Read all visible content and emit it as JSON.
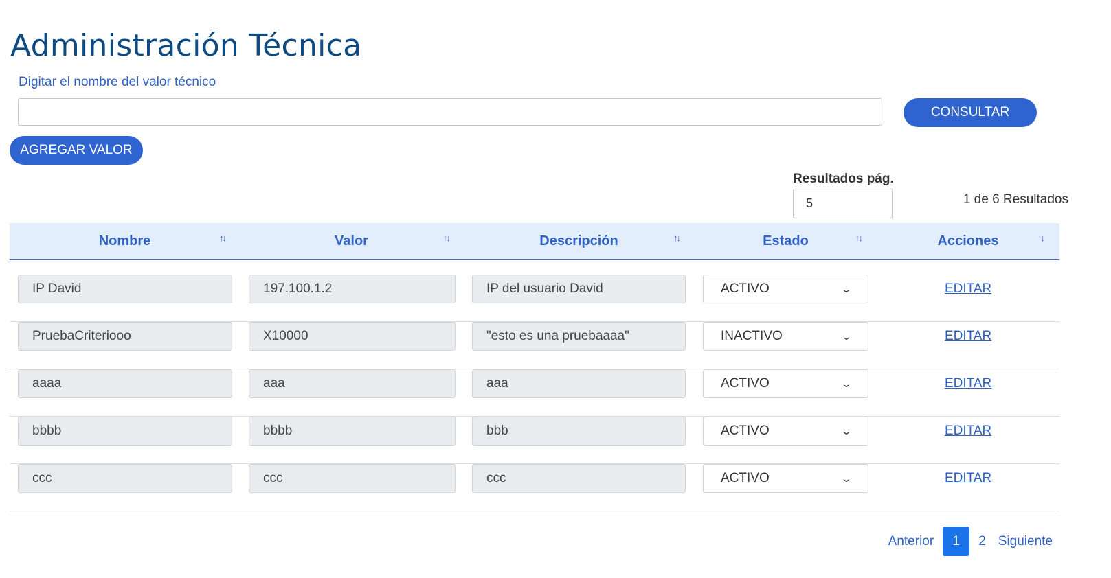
{
  "page": {
    "title": "Administración Técnica"
  },
  "search": {
    "label": "Digitar el nombre del valor técnico",
    "value": "",
    "placeholder": "",
    "consultar_label": "CONSULTAR",
    "agregar_label": "AGREGAR VALOR"
  },
  "paging": {
    "rpp_label": "Resultados pág.",
    "rpp_value": "5",
    "count_text": "1 de 6 Resultados"
  },
  "table": {
    "headers": [
      "Nombre",
      "Valor",
      "Descripción",
      "Estado",
      "Acciones"
    ],
    "rows": [
      {
        "nombre": "IP David",
        "valor": "197.100.1.2",
        "descripcion": "IP del usuario David",
        "estado": "ACTIVO",
        "accion": "EDITAR"
      },
      {
        "nombre": "PruebaCriteriooo",
        "valor": "X10000",
        "descripcion": "\"esto es una pruebaaaa\"",
        "estado": "INACTIVO",
        "accion": "EDITAR"
      },
      {
        "nombre": "aaaa",
        "valor": "aaa",
        "descripcion": "aaa",
        "estado": "ACTIVO",
        "accion": "EDITAR"
      },
      {
        "nombre": "bbbb",
        "valor": "bbbb",
        "descripcion": "bbb",
        "estado": "ACTIVO",
        "accion": "EDITAR"
      },
      {
        "nombre": "ccc",
        "valor": "ccc",
        "descripcion": "ccc",
        "estado": "ACTIVO",
        "accion": "EDITAR"
      }
    ]
  },
  "pagination": {
    "prev_label": "Anterior",
    "pages": [
      "1",
      "2"
    ],
    "active_page": "1",
    "next_label": "Siguiente"
  },
  "colors": {
    "primary": "#2f63cf",
    "title": "#0d4a82",
    "header_bg": "#e3eefc",
    "field_bg": "#e9ecef"
  },
  "icons": {
    "sort": "sort-arrows-icon",
    "dropdown": "chevron-down-icon"
  }
}
